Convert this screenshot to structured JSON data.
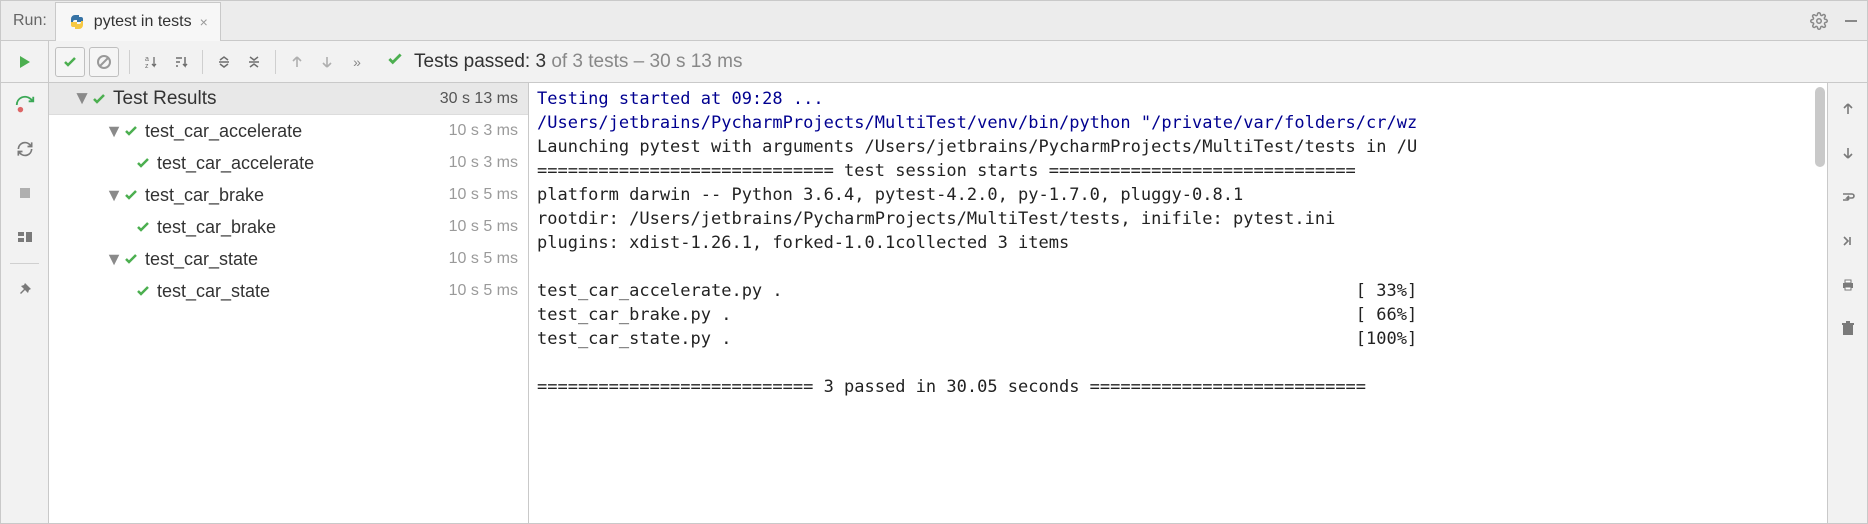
{
  "header": {
    "run_label": "Run:",
    "tab_label": "pytest in tests"
  },
  "status": {
    "prefix": "Tests passed:",
    "passed": "3",
    "of_text": "of 3 tests – 30 s 13 ms"
  },
  "tree": {
    "root_label": "Test Results",
    "root_time": "30 s 13 ms",
    "nodes": [
      {
        "label": "test_car_accelerate",
        "time": "10 s 3 ms",
        "children": [
          {
            "label": "test_car_accelerate",
            "time": "10 s 3 ms"
          }
        ]
      },
      {
        "label": "test_car_brake",
        "time": "10 s 5 ms",
        "children": [
          {
            "label": "test_car_brake",
            "time": "10 s 5 ms"
          }
        ]
      },
      {
        "label": "test_car_state",
        "time": "10 s 5 ms",
        "children": [
          {
            "label": "test_car_state",
            "time": "10 s 5 ms"
          }
        ]
      }
    ]
  },
  "console": {
    "line1": "Testing started at 09:28 ...",
    "line2": "/Users/jetbrains/PycharmProjects/MultiTest/venv/bin/python \"/private/var/folders/cr/wz",
    "line3": "Launching pytest with arguments /Users/jetbrains/PycharmProjects/MultiTest/tests in /U",
    "line4": "============================= test session starts ==============================",
    "line5": "platform darwin -- Python 3.6.4, pytest-4.2.0, py-1.7.0, pluggy-0.8.1",
    "line6": "rootdir: /Users/jetbrains/PycharmProjects/MultiTest/tests, inifile: pytest.ini",
    "line7": "plugins: xdist-1.26.1, forked-1.0.1collected 3 items",
    "line8": "",
    "line9a": "test_car_accelerate.py .",
    "line9b": "[ 33%]",
    "line10a": "test_car_brake.py .",
    "line10b": "[ 66%]",
    "line11a": "test_car_state.py .",
    "line11b": "[100%]",
    "line12": "",
    "line13": "=========================== 3 passed in 30.05 seconds ==========================="
  }
}
